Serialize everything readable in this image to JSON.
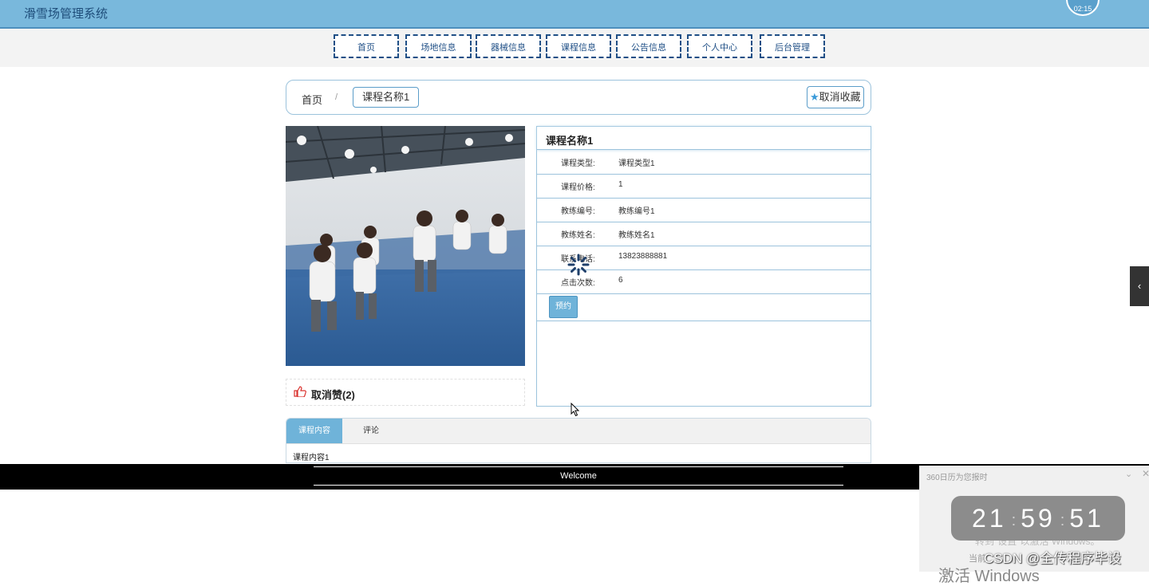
{
  "header": {
    "title": "滑雪场管理系统",
    "clock_badge": "02:15"
  },
  "nav": {
    "items": [
      "首页",
      "场地信息",
      "器械信息",
      "课程信息",
      "公告信息",
      "个人中心",
      "后台管理"
    ]
  },
  "breadcrumb": {
    "home": "首页",
    "separator": "/",
    "current": "课程名称1"
  },
  "favorite": {
    "label": "取消收藏"
  },
  "like": {
    "label": "取消赞(2)"
  },
  "course": {
    "name": "课程名称1",
    "fields": [
      {
        "label": "课程类型:",
        "value": "课程类型1"
      },
      {
        "label": "课程价格:",
        "value": "1"
      },
      {
        "label": "教练编号:",
        "value": "教练编号1"
      },
      {
        "label": "教练姓名:",
        "value": "教练姓名1"
      },
      {
        "label": "联系电话:",
        "value": "13823888881"
      },
      {
        "label": "点击次数:",
        "value": "6"
      }
    ],
    "book_label": "预约"
  },
  "tabs": {
    "items": [
      "课程内容",
      "评论"
    ],
    "active": 0,
    "content": "课程内容1"
  },
  "footer": {
    "text": "Welcome"
  },
  "widget": {
    "title": "360日历为您报时",
    "hours": "21",
    "minutes": "59",
    "seconds": "51",
    "activation_line1": "转到\"设置\"以激活 Windows。",
    "activation_line2": "当前",
    "activation_big": "激活 Windows"
  },
  "watermark": {
    "text": "CSDN @全传程序毕设"
  },
  "colors": {
    "header_bg": "#79b8dc",
    "accent": "#6fb3d9",
    "nav_border": "#1f4f86",
    "like_red": "#d9302c"
  }
}
